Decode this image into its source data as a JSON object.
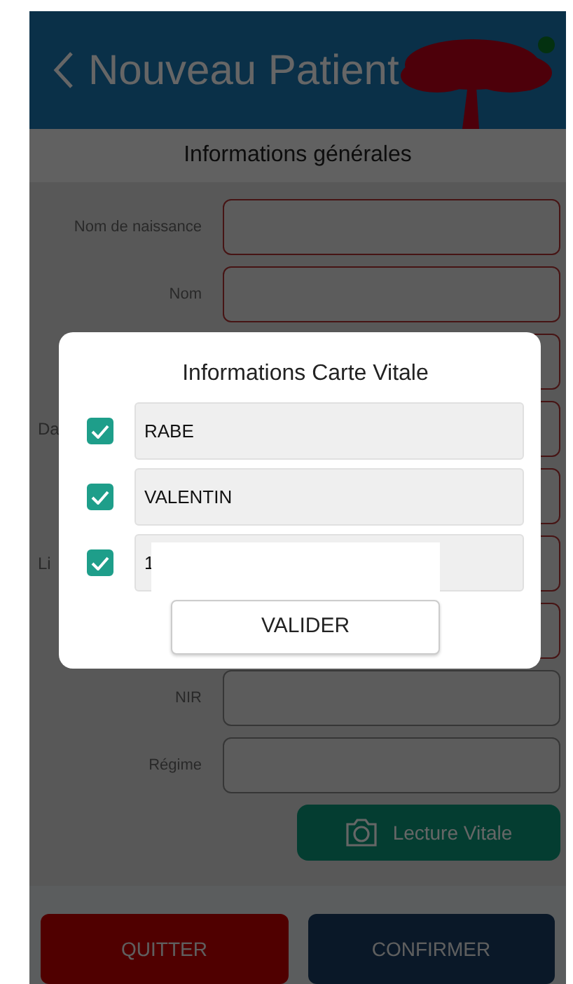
{
  "header": {
    "title": "Nouveau Patient"
  },
  "section": {
    "title": "Informations générales"
  },
  "form_rows": [
    {
      "label": "Nom de naissance",
      "partial": false,
      "invalid": true
    },
    {
      "label": "Nom",
      "partial": false,
      "invalid": true
    },
    {
      "label": "",
      "partial": false,
      "invalid": true
    },
    {
      "label": "Da",
      "partial": true,
      "invalid": true
    },
    {
      "label": "",
      "partial": false,
      "invalid": true
    },
    {
      "label": "Li",
      "partial": true,
      "invalid": true
    },
    {
      "label": "",
      "partial": false,
      "invalid": true
    },
    {
      "label": "NIR",
      "partial": false,
      "invalid": false
    },
    {
      "label": "Régime",
      "partial": false,
      "invalid": false
    }
  ],
  "read_button": {
    "label": "Lecture Vitale"
  },
  "footer_buttons": [
    {
      "label": "QUITTER",
      "kind": "danger"
    },
    {
      "label": "CONFIRMER",
      "kind": "primary"
    }
  ],
  "dialog": {
    "title": "Informations Carte Vitale",
    "fields": [
      {
        "value": "RABE",
        "checked": true,
        "redacted": false
      },
      {
        "value": "VALENTIN",
        "checked": true,
        "redacted": false
      },
      {
        "value": "1",
        "checked": true,
        "redacted": true
      }
    ],
    "button": {
      "label": "VALIDER"
    }
  }
}
